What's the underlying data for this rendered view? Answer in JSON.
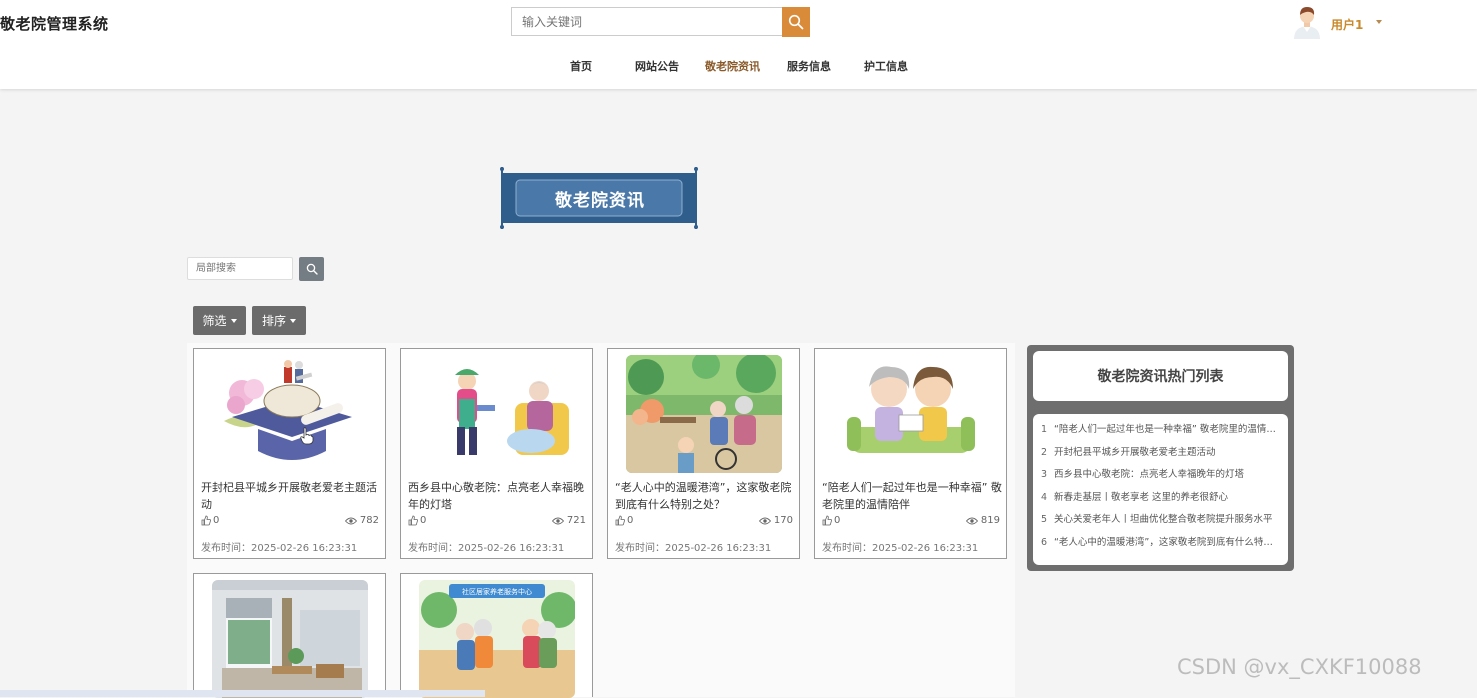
{
  "header": {
    "brand": "敬老院管理系统",
    "search_placeholder": "输入关键词",
    "user_name": "用户1"
  },
  "nav": {
    "items": [
      {
        "label": "首页",
        "active": false
      },
      {
        "label": "网站公告",
        "active": false
      },
      {
        "label": "敬老院资讯",
        "active": true
      },
      {
        "label": "服务信息",
        "active": false
      },
      {
        "label": "护工信息",
        "active": false
      }
    ]
  },
  "main": {
    "section_title": "敬老院资讯",
    "local_search_placeholder": "局部搜索",
    "filter_label": "筛选",
    "sort_label": "排序"
  },
  "cards": [
    {
      "title": "开封杞县平城乡开展敬老爱老主题活动",
      "likes": "0",
      "views": "782",
      "time": "发布时间：2025-02-26 16:23:31"
    },
    {
      "title": "西乡县中心敬老院：点亮老人幸福晚年的灯塔",
      "likes": "0",
      "views": "721",
      "time": "发布时间：2025-02-26 16:23:31"
    },
    {
      "title": "“老人心中的温暖港湾”，这家敬老院到底有什么特别之处？",
      "likes": "0",
      "views": "170",
      "time": "发布时间：2025-02-26 16:23:31"
    },
    {
      "title": "“陪老人们一起过年也是一种幸福” 敬老院里的温情陪伴",
      "likes": "0",
      "views": "819",
      "time": "发布时间：2025-02-26 16:23:31"
    },
    {
      "title": "",
      "likes": "",
      "views": "",
      "time": ""
    },
    {
      "title": "",
      "likes": "",
      "views": "",
      "time": "",
      "sign": "社区居家养老服务中心"
    }
  ],
  "hot": {
    "title": "敬老院资讯热门列表",
    "items": [
      {
        "num": "1",
        "text": "“陪老人们一起过年也是一种幸福” 敬老院里的温情陪伴"
      },
      {
        "num": "2",
        "text": "开封杞县平城乡开展敬老爱老主题活动"
      },
      {
        "num": "3",
        "text": "西乡县中心敬老院：点亮老人幸福晚年的灯塔"
      },
      {
        "num": "4",
        "text": "新春走基层丨敬老享老 这里的养老很舒心"
      },
      {
        "num": "5",
        "text": "关心关爱老年人丨坦曲优化整合敬老院提升服务水平"
      },
      {
        "num": "6",
        "text": "“老人心中的温暖港湾”，这家敬老院到底有什么特别之处？"
      }
    ]
  },
  "watermark": "CSDN @vx_CXKF10088",
  "colors": {
    "accent": "#d98b3a",
    "nav_active": "#8a5a2a",
    "banner": "#4a78a8",
    "hot_frame": "#6e6e6e"
  }
}
